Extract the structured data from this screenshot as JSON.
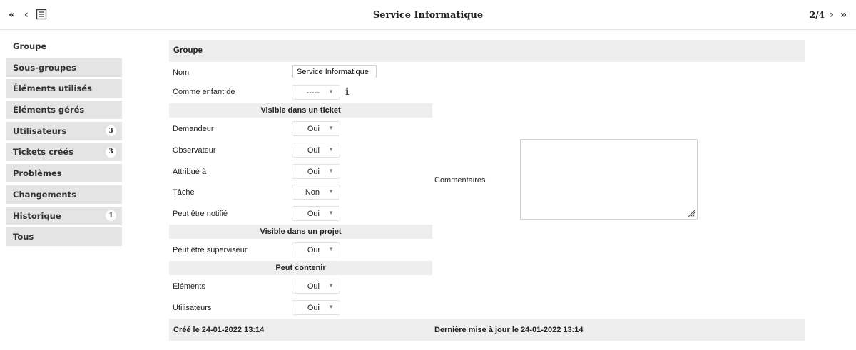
{
  "topbar": {
    "title": "Service Informatique",
    "pager": "2/4",
    "first_icon": "double-chevron-left-icon",
    "prev_icon": "chevron-left-icon",
    "list_icon": "list-icon",
    "next_icon": "chevron-right-icon",
    "last_icon": "double-chevron-right-icon"
  },
  "sidebar": {
    "items": [
      {
        "label": "Groupe",
        "badge": ""
      },
      {
        "label": "Sous-groupes",
        "badge": ""
      },
      {
        "label": "Éléments utilisés",
        "badge": ""
      },
      {
        "label": "Éléments gérés",
        "badge": ""
      },
      {
        "label": "Utilisateurs",
        "badge": "3"
      },
      {
        "label": "Tickets créés",
        "badge": "3"
      },
      {
        "label": "Problèmes",
        "badge": ""
      },
      {
        "label": "Changements",
        "badge": ""
      },
      {
        "label": "Historique",
        "badge": "1"
      },
      {
        "label": "Tous",
        "badge": ""
      }
    ]
  },
  "form": {
    "header": "Groupe",
    "name_label": "Nom",
    "name_value": "Service Informatique",
    "parent_label": "Comme enfant de",
    "parent_value": "-----",
    "section_ticket": "Visible dans un ticket",
    "requester_label": "Demandeur",
    "requester_value": "Oui",
    "observer_label": "Observateur",
    "observer_value": "Oui",
    "assigned_label": "Attribué à",
    "assigned_value": "Oui",
    "task_label": "Tâche",
    "task_value": "Non",
    "notify_label": "Peut être notifié",
    "notify_value": "Oui",
    "section_project": "Visible dans un projet",
    "supervisor_label": "Peut être superviseur",
    "supervisor_value": "Oui",
    "section_contain": "Peut contenir",
    "items_label": "Éléments",
    "items_value": "Oui",
    "users_label": "Utilisateurs",
    "users_value": "Oui",
    "comments_label": "Commentaires",
    "created": "Créé le 24-01-2022 13:14",
    "updated": "Dernière mise à jour le 24-01-2022 13:14"
  }
}
